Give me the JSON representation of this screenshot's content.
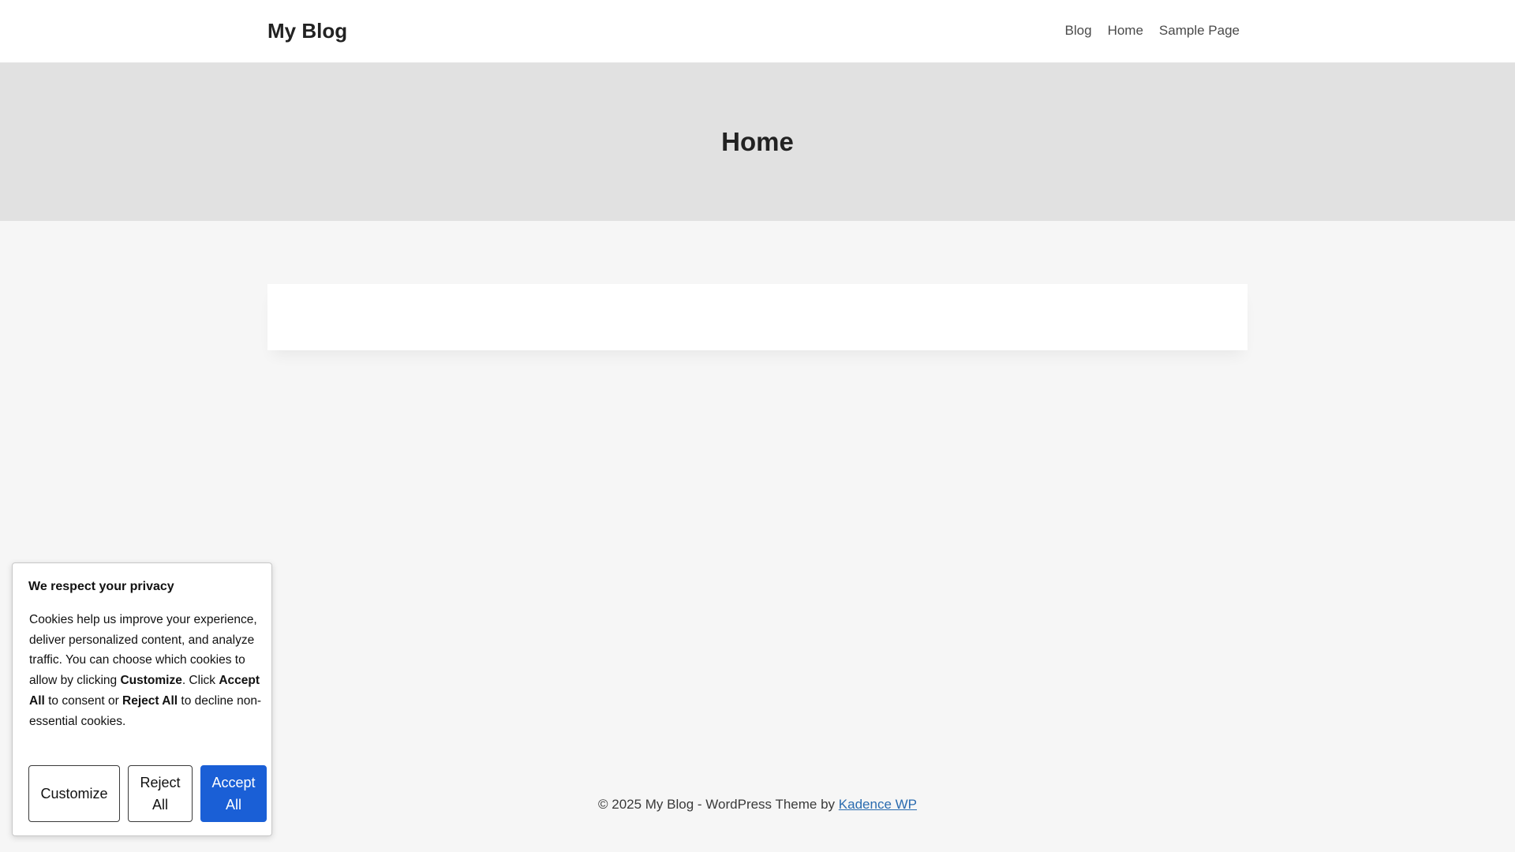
{
  "header": {
    "site_title": "My Blog",
    "nav": [
      {
        "label": "Blog"
      },
      {
        "label": "Home"
      },
      {
        "label": "Sample Page"
      }
    ]
  },
  "hero": {
    "title": "Home"
  },
  "footer": {
    "prefix": "© 2025 My Blog - WordPress Theme by ",
    "link_label": "Kadence WP"
  },
  "cookie_banner": {
    "title": "We respect your privacy",
    "text_parts": {
      "p1": "Cookies help us improve your experience, deliver personalized content, and analyze traffic. You can choose which cookies to allow by clicking ",
      "b1": "Customize",
      "p2": ". Click ",
      "b2": "Accept All",
      "p3": " to consent or ",
      "b3": "Reject All",
      "p4": " to decline non-essential cookies."
    },
    "buttons": {
      "customize": "Customize",
      "reject": "Reject All",
      "accept": "Accept All"
    },
    "accept_color": "#1a5fd6"
  }
}
